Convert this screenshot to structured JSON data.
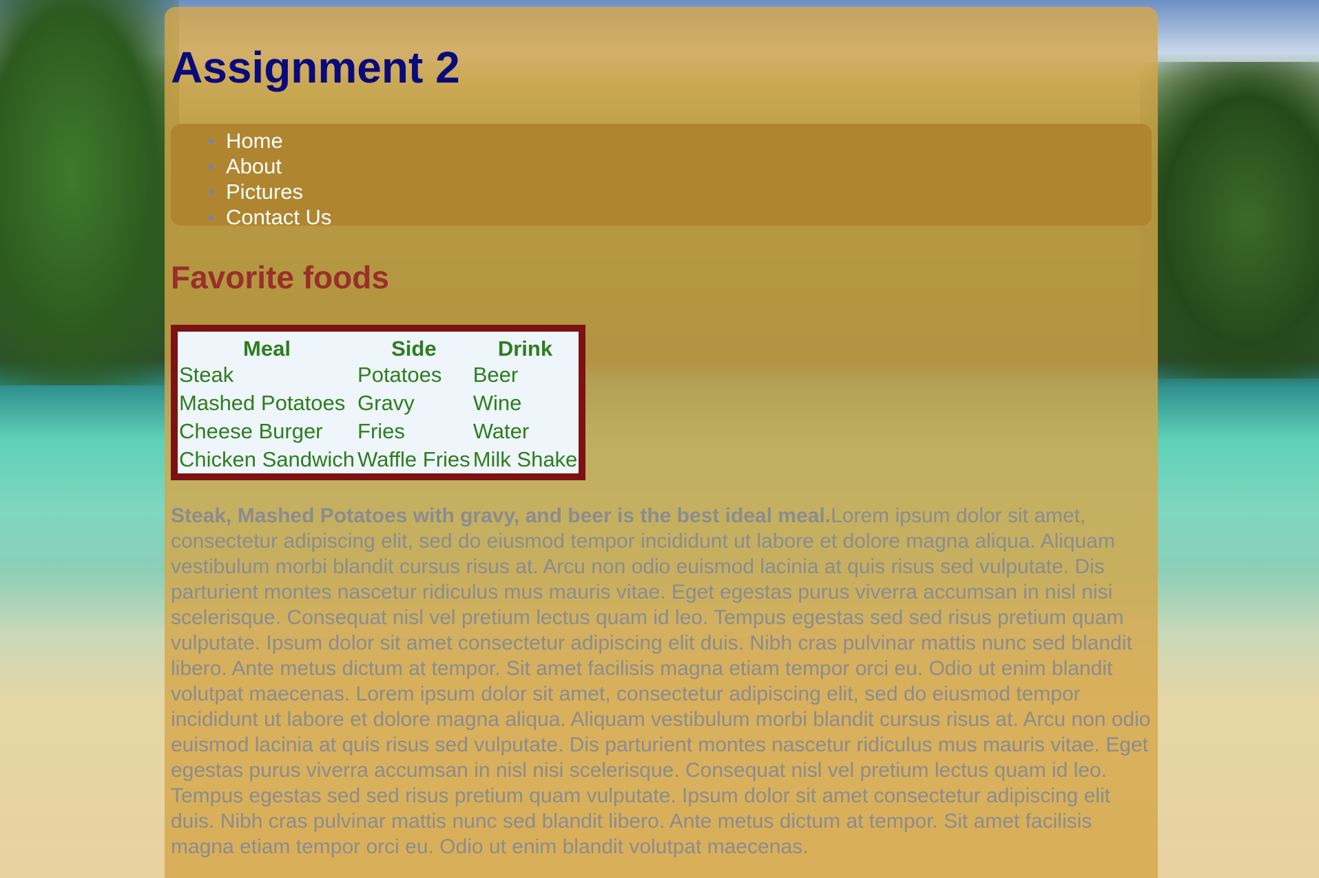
{
  "page": {
    "title": "Assignment 2"
  },
  "nav": {
    "items": [
      {
        "label": "Home"
      },
      {
        "label": "About"
      },
      {
        "label": "Pictures"
      },
      {
        "label": "Contact Us"
      }
    ]
  },
  "section": {
    "heading": "Favorite foods"
  },
  "table": {
    "headers": [
      "Meal",
      "Side",
      "Drink"
    ],
    "rows": [
      [
        "Steak",
        "Potatoes",
        "Beer"
      ],
      [
        "Mashed Potatoes",
        "Gravy",
        "Wine"
      ],
      [
        "Cheese Burger",
        "Fries",
        "Water"
      ],
      [
        "Chicken Sandwich",
        "Waffle Fries",
        "Milk Shake"
      ]
    ]
  },
  "paragraph": {
    "lead": "Steak, Mashed Potatoes with gravy, and beer is the best ideal meal.",
    "body": "Lorem ipsum dolor sit amet, consectetur adipiscing elit, sed do eiusmod tempor incididunt ut labore et dolore magna aliqua. Aliquam vestibulum morbi blandit cursus risus at. Arcu non odio euismod lacinia at quis risus sed vulputate. Dis parturient montes nascetur ridiculus mus mauris vitae. Eget egestas purus viverra accumsan in nisl nisi scelerisque. Consequat nisl vel pretium lectus quam id leo. Tempus egestas sed sed risus pretium quam vulputate. Ipsum dolor sit amet consectetur adipiscing elit duis. Nibh cras pulvinar mattis nunc sed blandit libero. Ante metus dictum at tempor. Sit amet facilisis magna etiam tempor orci eu. Odio ut enim blandit volutpat maecenas. Lorem ipsum dolor sit amet, consectetur adipiscing elit, sed do eiusmod tempor incididunt ut labore et dolore magna aliqua. Aliquam vestibulum morbi blandit cursus risus at. Arcu non odio euismod lacinia at quis risus sed vulputate. Dis parturient montes nascetur ridiculus mus mauris vitae. Eget egestas purus viverra accumsan in nisl nisi scelerisque. Consequat nisl vel pretium lectus quam id leo. Tempus egestas sed sed risus pretium quam vulputate. Ipsum dolor sit amet consectetur adipiscing elit duis. Nibh cras pulvinar mattis nunc sed blandit libero. Ante metus dictum at tempor. Sit amet facilisis magna etiam tempor orci eu. Odio ut enim blandit volutpat maecenas."
  },
  "colors": {
    "title": "#0a0a7a",
    "nav_background": "#b08530",
    "heading": "#9a2e2a",
    "table_border": "#7c1212",
    "table_text": "#2e7d1e",
    "paragraph_text": "#8a8c90"
  }
}
